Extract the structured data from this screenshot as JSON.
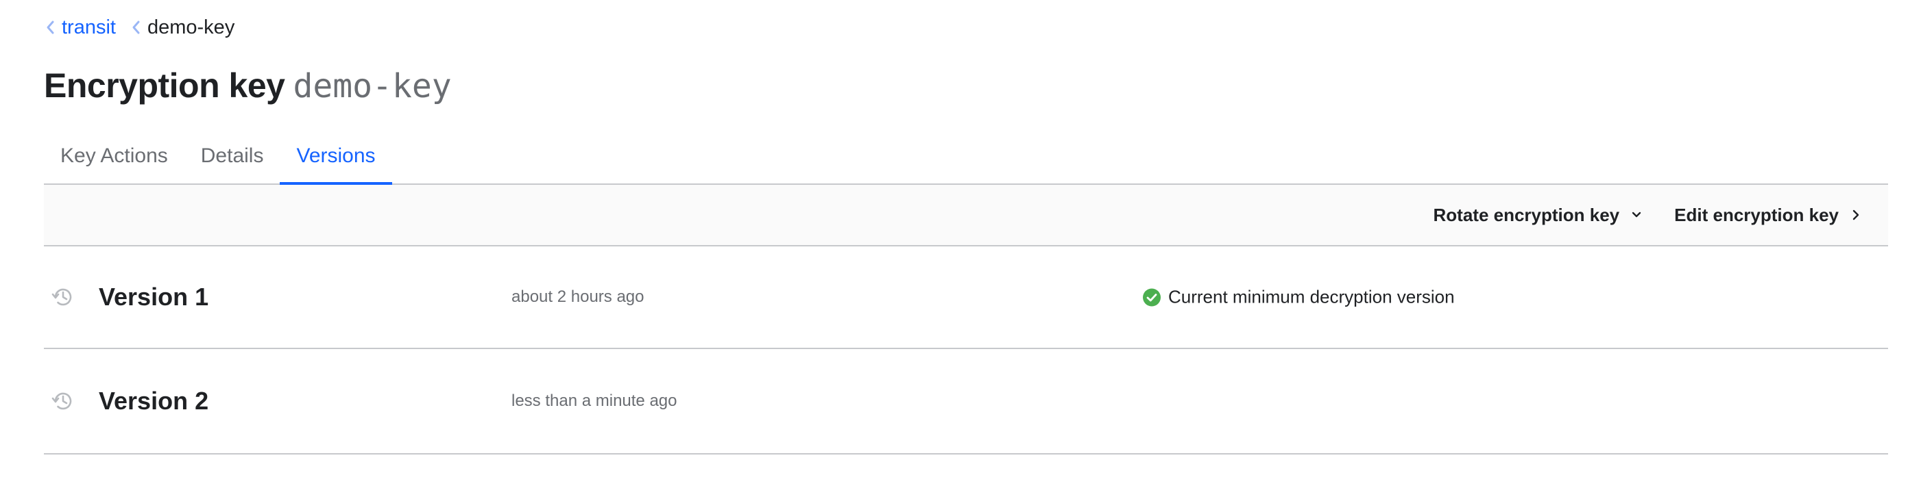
{
  "breadcrumb": {
    "items": [
      {
        "label": "transit",
        "link": true
      },
      {
        "label": "demo-key",
        "link": false
      }
    ]
  },
  "header": {
    "title": "Encryption key",
    "key_name": "demo-key"
  },
  "tabs": [
    {
      "label": "Key Actions",
      "active": false
    },
    {
      "label": "Details",
      "active": false
    },
    {
      "label": "Versions",
      "active": true
    }
  ],
  "toolbar": {
    "rotate_label": "Rotate encryption key",
    "rotate_icon": "chevron-down-icon",
    "edit_label": "Edit encryption key",
    "edit_icon": "chevron-right-icon"
  },
  "versions": [
    {
      "name": "Version 1",
      "time": "about 2 hours ago",
      "status": "Current minimum decryption version",
      "icon": "history-icon"
    },
    {
      "name": "Version 2",
      "time": "less than a minute ago",
      "status": "",
      "icon": "history-icon"
    }
  ],
  "colors": {
    "accent": "#1563ff",
    "success": "#4caf50",
    "muted_text": "#6a6d72",
    "border": "#c7c9cc",
    "toolbar_bg": "#fafafa"
  }
}
